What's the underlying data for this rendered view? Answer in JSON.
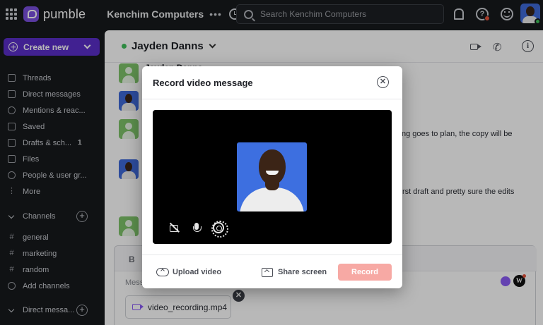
{
  "app": {
    "name": "pumble",
    "workspace": "Kenchim Computers",
    "more": "•••"
  },
  "search": {
    "placeholder": "Search Kenchim Computers"
  },
  "sidebar": {
    "create_label": "Create new",
    "nav": [
      {
        "label": "Threads",
        "icon": "threads-icon"
      },
      {
        "label": "Direct messages",
        "icon": "direct-messages-icon"
      },
      {
        "label": "Mentions & reac...",
        "icon": "mention-icon"
      },
      {
        "label": "Saved",
        "icon": "bookmark-icon"
      },
      {
        "label": "Drafts & sch...",
        "icon": "drafts-icon",
        "badge": "1"
      },
      {
        "label": "Files",
        "icon": "files-icon"
      },
      {
        "label": "People & user gr...",
        "icon": "people-icon"
      },
      {
        "label": "More",
        "icon": "more-icon"
      }
    ],
    "channels_label": "Channels",
    "channels": [
      "general",
      "marketing",
      "random"
    ],
    "add_channels": "Add channels",
    "direct_label": "Direct messa..."
  },
  "chat": {
    "name": "Jayden Danns",
    "author_partial": "Jayden Danns",
    "msg1_partial": "ng goes to plan, the copy will be",
    "msg2_partial": "rst draft and pretty sure the edits",
    "composer_bold": "B",
    "composer_placeholder": "Mess",
    "ai_icon": "sparkle-icon",
    "attachment": "video_recording.mp4",
    "attachment_remove": "✕"
  },
  "modal": {
    "title": "Record video message",
    "close": "✕",
    "upload_label": "Upload video",
    "share_label": "Share screen",
    "record_label": "Record"
  },
  "colors": {
    "accent": "#5b2fc9",
    "record": "#f7a9a4",
    "online": "#3fbf5a"
  }
}
